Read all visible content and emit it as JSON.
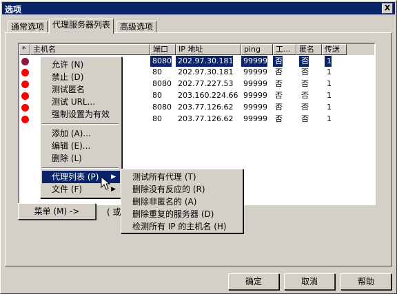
{
  "window": {
    "title": "选项",
    "close_glyph": "X"
  },
  "tabs": [
    {
      "label": "通常选项",
      "active": false
    },
    {
      "label": "代理服务器列表",
      "active": true
    },
    {
      "label": "高级选项",
      "active": false
    }
  ],
  "table": {
    "columns": [
      "*",
      "主机名",
      "端口",
      "IP 地址",
      "ping",
      "工...",
      "匿名",
      "传送"
    ],
    "rows": [
      {
        "port": "8080",
        "ip": "202.97.30.181",
        "ping": "99999",
        "work": "否",
        "anon": "否",
        "transfer": "1",
        "status": "dark",
        "selected": true
      },
      {
        "port": "80",
        "ip": "202.97.30.181",
        "ping": "99999",
        "work": "否",
        "anon": "否",
        "transfer": "1",
        "status": "red",
        "selected": false
      },
      {
        "port": "8080",
        "ip": "202.77.227.53",
        "ping": "99999",
        "work": "否",
        "anon": "否",
        "transfer": "1",
        "status": "red",
        "selected": false
      },
      {
        "port": "80",
        "ip": "203.160.224.66",
        "ping": "99999",
        "work": "否",
        "anon": "否",
        "transfer": "1",
        "status": "red",
        "selected": false
      },
      {
        "port": "8080",
        "ip": "203.77.126.62",
        "ping": "99999",
        "work": "否",
        "anon": "否",
        "transfer": "1",
        "status": "red",
        "selected": false
      },
      {
        "port": "80",
        "ip": "203.77.126.62",
        "ping": "99999",
        "work": "否",
        "anon": "否",
        "transfer": "1",
        "status": "red",
        "selected": false
      }
    ]
  },
  "context_menu": {
    "items": [
      "允许 (N)",
      "禁止 (D)",
      "测试匿名",
      "测试 URL...",
      "强制设置为有效",
      "添加 (A)...",
      "编辑 (E)...",
      "删除 (L)",
      "代理列表 (P)",
      "文件 (F)"
    ]
  },
  "submenu": {
    "items": [
      "测试所有代理 (T)",
      "删除没有反应的 (R)",
      "删除非匿名的 (A)",
      "删除重复的服务器 (D)",
      "检测所有 IP 的主机名 (H)"
    ]
  },
  "menu_button": {
    "label": "菜单 (M) ->"
  },
  "partial_text": "( 或",
  "buttons": {
    "ok": "确定",
    "cancel": "取消",
    "help": "帮助"
  },
  "colors": {
    "selection": "#0a246a",
    "status_red": "#ff0000",
    "status_dark": "#8b1a3a",
    "face": "#d4d0c8"
  }
}
